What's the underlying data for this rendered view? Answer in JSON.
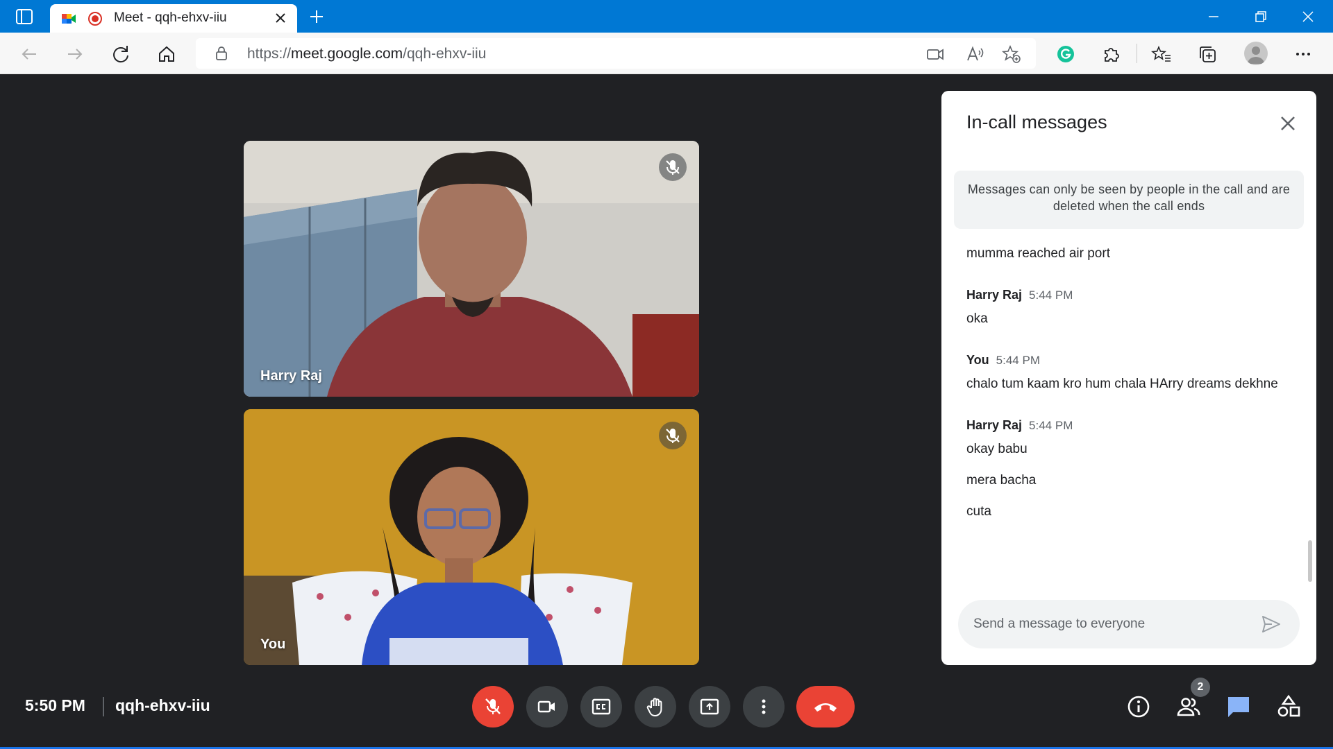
{
  "browser": {
    "tab_title": "Meet - qqh-ehxv-iiu",
    "url_prefix": "https://",
    "url_host": "meet.google.com",
    "url_path": "/qqh-ehxv-iiu",
    "accent": "#0078d4"
  },
  "participants": [
    {
      "name": "Harry Raj",
      "muted": true
    },
    {
      "name": "You",
      "muted": true
    }
  ],
  "chat": {
    "title": "In-call messages",
    "notice": "Messages can only be seen by people in the call and are deleted when the call ends",
    "first_message": "mumma reached air port",
    "groups": [
      {
        "author": "Harry Raj",
        "time": "5:44 PM",
        "messages": [
          "oka"
        ]
      },
      {
        "author": "You",
        "time": "5:44 PM",
        "messages": [
          "chalo tum kaam kro hum chala HArry dreams dekhne"
        ]
      },
      {
        "author": "Harry Raj",
        "time": "5:44 PM",
        "messages": [
          "okay babu",
          "mera bacha",
          "cuta"
        ]
      }
    ],
    "input_placeholder": "Send a message to everyone"
  },
  "meeting": {
    "time": "5:50 PM",
    "code": "qqh-ehxv-iiu",
    "people_count": "2",
    "danger_color": "#ea4335",
    "chat_active_color": "#8ab4f8"
  }
}
